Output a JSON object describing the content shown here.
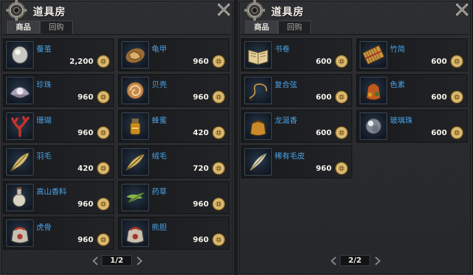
{
  "panels": [
    {
      "title": "道具房",
      "tabs": [
        "商品",
        "回购"
      ],
      "page_label": "1/2",
      "items": [
        {
          "name": "蚕茧",
          "price": "2,200",
          "icon": "cocoon-icon"
        },
        {
          "name": "龟甲",
          "price": "960",
          "icon": "tortoise-shell-icon"
        },
        {
          "name": "珍珠",
          "price": "960",
          "icon": "pearl-shell-icon"
        },
        {
          "name": "贝壳",
          "price": "960",
          "icon": "nautilus-shell-icon"
        },
        {
          "name": "珊瑚",
          "price": "960",
          "icon": "coral-icon"
        },
        {
          "name": "蜂蜜",
          "price": "420",
          "icon": "honey-jar-icon"
        },
        {
          "name": "羽毛",
          "price": "420",
          "icon": "feather-icon"
        },
        {
          "name": "绒毛",
          "price": "720",
          "icon": "down-feather-icon"
        },
        {
          "name": "高山香料",
          "price": "960",
          "icon": "spice-bottle-icon"
        },
        {
          "name": "药草",
          "price": "960",
          "icon": "herb-icon"
        },
        {
          "name": "虎骨",
          "price": "960",
          "icon": "tiger-bone-pouch-icon"
        },
        {
          "name": "熊胆",
          "price": "960",
          "icon": "bear-gall-pouch-icon"
        }
      ]
    },
    {
      "title": "道具房",
      "tabs": [
        "商品",
        "回购"
      ],
      "page_label": "2/2",
      "items": [
        {
          "name": "书卷",
          "price": "600",
          "icon": "book-scroll-icon"
        },
        {
          "name": "竹简",
          "price": "600",
          "icon": "bamboo-slips-icon"
        },
        {
          "name": "复合弦",
          "price": "600",
          "icon": "bowstring-icon"
        },
        {
          "name": "色素",
          "price": "600",
          "icon": "pigment-bag-icon"
        },
        {
          "name": "龙涎香",
          "price": "600",
          "icon": "ambergris-pouch-icon"
        },
        {
          "name": "玻璃珠",
          "price": "600",
          "icon": "glass-bead-icon"
        },
        {
          "name": "稀有毛皮",
          "price": "960",
          "icon": "rare-fur-quill-icon"
        }
      ]
    }
  ],
  "colors": {
    "item_name": "#4aa3e6",
    "price_text": "#f4f2ea",
    "coin": "#c9a55a",
    "panel_bg": "#2a2c2f"
  }
}
